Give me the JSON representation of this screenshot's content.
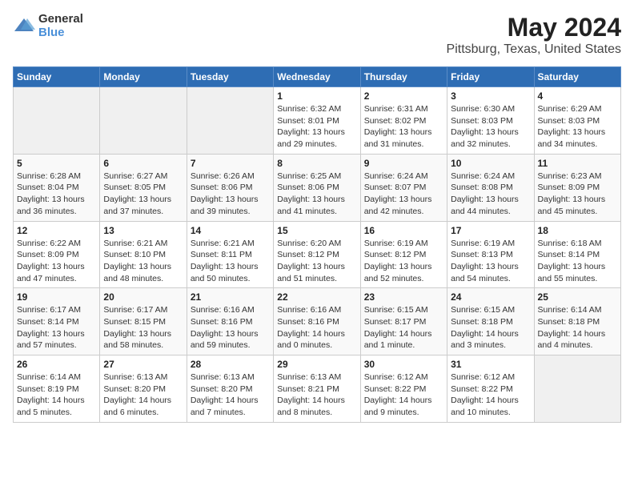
{
  "header": {
    "logo_line1": "General",
    "logo_line2": "Blue",
    "title": "May 2024",
    "subtitle": "Pittsburg, Texas, United States"
  },
  "days_of_week": [
    "Sunday",
    "Monday",
    "Tuesday",
    "Wednesday",
    "Thursday",
    "Friday",
    "Saturday"
  ],
  "weeks": [
    [
      {
        "day": "",
        "info": ""
      },
      {
        "day": "",
        "info": ""
      },
      {
        "day": "",
        "info": ""
      },
      {
        "day": "1",
        "info": "Sunrise: 6:32 AM\nSunset: 8:01 PM\nDaylight: 13 hours and 29 minutes."
      },
      {
        "day": "2",
        "info": "Sunrise: 6:31 AM\nSunset: 8:02 PM\nDaylight: 13 hours and 31 minutes."
      },
      {
        "day": "3",
        "info": "Sunrise: 6:30 AM\nSunset: 8:03 PM\nDaylight: 13 hours and 32 minutes."
      },
      {
        "day": "4",
        "info": "Sunrise: 6:29 AM\nSunset: 8:03 PM\nDaylight: 13 hours and 34 minutes."
      }
    ],
    [
      {
        "day": "5",
        "info": "Sunrise: 6:28 AM\nSunset: 8:04 PM\nDaylight: 13 hours and 36 minutes."
      },
      {
        "day": "6",
        "info": "Sunrise: 6:27 AM\nSunset: 8:05 PM\nDaylight: 13 hours and 37 minutes."
      },
      {
        "day": "7",
        "info": "Sunrise: 6:26 AM\nSunset: 8:06 PM\nDaylight: 13 hours and 39 minutes."
      },
      {
        "day": "8",
        "info": "Sunrise: 6:25 AM\nSunset: 8:06 PM\nDaylight: 13 hours and 41 minutes."
      },
      {
        "day": "9",
        "info": "Sunrise: 6:24 AM\nSunset: 8:07 PM\nDaylight: 13 hours and 42 minutes."
      },
      {
        "day": "10",
        "info": "Sunrise: 6:24 AM\nSunset: 8:08 PM\nDaylight: 13 hours and 44 minutes."
      },
      {
        "day": "11",
        "info": "Sunrise: 6:23 AM\nSunset: 8:09 PM\nDaylight: 13 hours and 45 minutes."
      }
    ],
    [
      {
        "day": "12",
        "info": "Sunrise: 6:22 AM\nSunset: 8:09 PM\nDaylight: 13 hours and 47 minutes."
      },
      {
        "day": "13",
        "info": "Sunrise: 6:21 AM\nSunset: 8:10 PM\nDaylight: 13 hours and 48 minutes."
      },
      {
        "day": "14",
        "info": "Sunrise: 6:21 AM\nSunset: 8:11 PM\nDaylight: 13 hours and 50 minutes."
      },
      {
        "day": "15",
        "info": "Sunrise: 6:20 AM\nSunset: 8:12 PM\nDaylight: 13 hours and 51 minutes."
      },
      {
        "day": "16",
        "info": "Sunrise: 6:19 AM\nSunset: 8:12 PM\nDaylight: 13 hours and 52 minutes."
      },
      {
        "day": "17",
        "info": "Sunrise: 6:19 AM\nSunset: 8:13 PM\nDaylight: 13 hours and 54 minutes."
      },
      {
        "day": "18",
        "info": "Sunrise: 6:18 AM\nSunset: 8:14 PM\nDaylight: 13 hours and 55 minutes."
      }
    ],
    [
      {
        "day": "19",
        "info": "Sunrise: 6:17 AM\nSunset: 8:14 PM\nDaylight: 13 hours and 57 minutes."
      },
      {
        "day": "20",
        "info": "Sunrise: 6:17 AM\nSunset: 8:15 PM\nDaylight: 13 hours and 58 minutes."
      },
      {
        "day": "21",
        "info": "Sunrise: 6:16 AM\nSunset: 8:16 PM\nDaylight: 13 hours and 59 minutes."
      },
      {
        "day": "22",
        "info": "Sunrise: 6:16 AM\nSunset: 8:16 PM\nDaylight: 14 hours and 0 minutes."
      },
      {
        "day": "23",
        "info": "Sunrise: 6:15 AM\nSunset: 8:17 PM\nDaylight: 14 hours and 1 minute."
      },
      {
        "day": "24",
        "info": "Sunrise: 6:15 AM\nSunset: 8:18 PM\nDaylight: 14 hours and 3 minutes."
      },
      {
        "day": "25",
        "info": "Sunrise: 6:14 AM\nSunset: 8:18 PM\nDaylight: 14 hours and 4 minutes."
      }
    ],
    [
      {
        "day": "26",
        "info": "Sunrise: 6:14 AM\nSunset: 8:19 PM\nDaylight: 14 hours and 5 minutes."
      },
      {
        "day": "27",
        "info": "Sunrise: 6:13 AM\nSunset: 8:20 PM\nDaylight: 14 hours and 6 minutes."
      },
      {
        "day": "28",
        "info": "Sunrise: 6:13 AM\nSunset: 8:20 PM\nDaylight: 14 hours and 7 minutes."
      },
      {
        "day": "29",
        "info": "Sunrise: 6:13 AM\nSunset: 8:21 PM\nDaylight: 14 hours and 8 minutes."
      },
      {
        "day": "30",
        "info": "Sunrise: 6:12 AM\nSunset: 8:22 PM\nDaylight: 14 hours and 9 minutes."
      },
      {
        "day": "31",
        "info": "Sunrise: 6:12 AM\nSunset: 8:22 PM\nDaylight: 14 hours and 10 minutes."
      },
      {
        "day": "",
        "info": ""
      }
    ]
  ]
}
